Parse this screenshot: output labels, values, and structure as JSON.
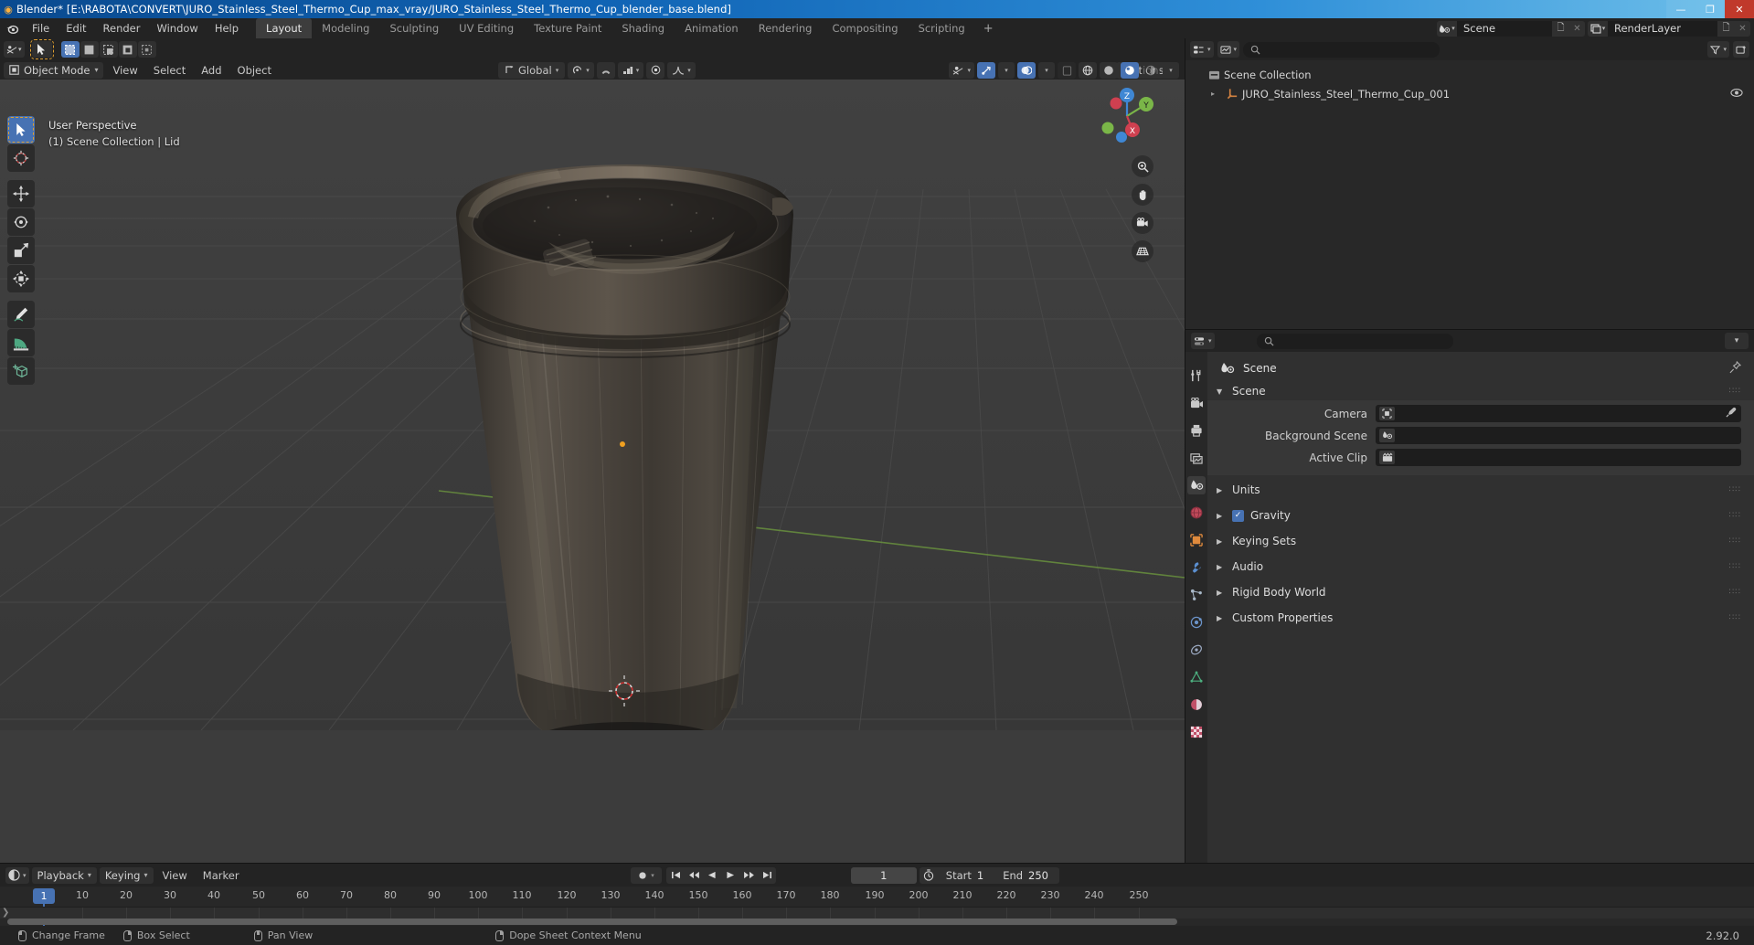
{
  "window": {
    "title": "Blender* [E:\\RABOTA\\CONVERT\\JURO_Stainless_Steel_Thermo_Cup_max_vray/JURO_Stainless_Steel_Thermo_Cup_blender_base.blend]",
    "minimize": "—",
    "maximize": "❐",
    "close": "✕"
  },
  "topbar": {
    "menus": [
      "File",
      "Edit",
      "Render",
      "Window",
      "Help"
    ],
    "workspaces": [
      "Layout",
      "Modeling",
      "Sculpting",
      "UV Editing",
      "Texture Paint",
      "Shading",
      "Animation",
      "Rendering",
      "Compositing",
      "Scripting"
    ],
    "active_workspace": "Layout",
    "add_workspace": "+",
    "scene_name": "Scene",
    "view_layer_name": "RenderLayer"
  },
  "viewport": {
    "mode": "Object Mode",
    "menus": [
      "View",
      "Select",
      "Add",
      "Object"
    ],
    "transform_orientation": "Global",
    "options_label": "Options",
    "overlay_line1": "User Perspective",
    "overlay_line2": "(1) Scene Collection | Lid",
    "gizmo_axes": [
      "X",
      "Y",
      "Z"
    ],
    "nav_buttons": [
      "zoom-icon",
      "hand-icon",
      "camera-icon",
      "grid-icon"
    ],
    "tools": [
      "tweak-select-tool",
      "cursor-tool",
      "move-tool",
      "rotate-tool",
      "scale-tool",
      "transform-tool",
      "annotate-tool",
      "measure-tool",
      "add-cube-tool"
    ]
  },
  "outliner": {
    "search_placeholder": "",
    "root": "Scene Collection",
    "items": [
      {
        "label": "JURO_Stainless_Steel_Thermo_Cup_001",
        "expand": "▸",
        "visible": true
      }
    ]
  },
  "properties": {
    "search_placeholder": "",
    "context_title": "Scene",
    "tabs": [
      "tool-icon",
      "render-icon",
      "output-icon",
      "view-layer-icon",
      "scene-icon",
      "world-icon",
      "object-icon",
      "modifier-icon",
      "particles-icon",
      "physics-icon",
      "constraints-icon",
      "data-icon",
      "material-icon",
      "texture-icon"
    ],
    "active_tab": "scene-icon",
    "panels": [
      {
        "name": "Scene",
        "open": true,
        "rows": [
          {
            "label": "Camera",
            "value": "",
            "icon": "camera-data-icon",
            "eyedropper": true
          },
          {
            "label": "Background Scene",
            "value": "",
            "icon": "scene-icon",
            "eyedropper": false
          },
          {
            "label": "Active Clip",
            "value": "",
            "icon": "clip-icon",
            "eyedropper": false
          }
        ]
      },
      {
        "name": "Units",
        "open": false,
        "checkbox": null
      },
      {
        "name": "Gravity",
        "open": false,
        "checkbox": true
      },
      {
        "name": "Keying Sets",
        "open": false,
        "checkbox": null
      },
      {
        "name": "Audio",
        "open": false,
        "checkbox": null
      },
      {
        "name": "Rigid Body World",
        "open": false,
        "checkbox": null
      },
      {
        "name": "Custom Properties",
        "open": false,
        "checkbox": null
      }
    ]
  },
  "timeline": {
    "menus": [
      "View",
      "Marker"
    ],
    "playback_label": "Playback",
    "keying_label": "Keying",
    "current_frame": "1",
    "start_label": "Start",
    "start_value": "1",
    "end_label": "End",
    "end_value": "250",
    "playback_buttons": [
      "jump-to-start",
      "jump-prev-keyframe",
      "play-reverse",
      "play",
      "jump-next-keyframe",
      "jump-to-end"
    ],
    "ticks": [
      "1",
      "10",
      "20",
      "30",
      "40",
      "50",
      "60",
      "70",
      "80",
      "90",
      "100",
      "110",
      "120",
      "130",
      "140",
      "150",
      "160",
      "170",
      "180",
      "190",
      "200",
      "210",
      "220",
      "230",
      "240",
      "250"
    ]
  },
  "statusbar": {
    "hints": [
      {
        "mouse": "left",
        "label": "Change Frame"
      },
      {
        "mouse": "right",
        "label": "Box Select"
      },
      {
        "mouse": "middle",
        "label": "Pan View"
      },
      {
        "mouse": "right2",
        "label": "Dope Sheet Context Menu"
      }
    ],
    "version": "2.92.0"
  },
  "colors": {
    "accent_blue": "#4772b3",
    "axis_x_red": "#cf4050",
    "axis_y_green": "#7ab648",
    "title_blue": "#1064b5",
    "panel_bg": "#303030",
    "editor_bg": "#282828"
  }
}
